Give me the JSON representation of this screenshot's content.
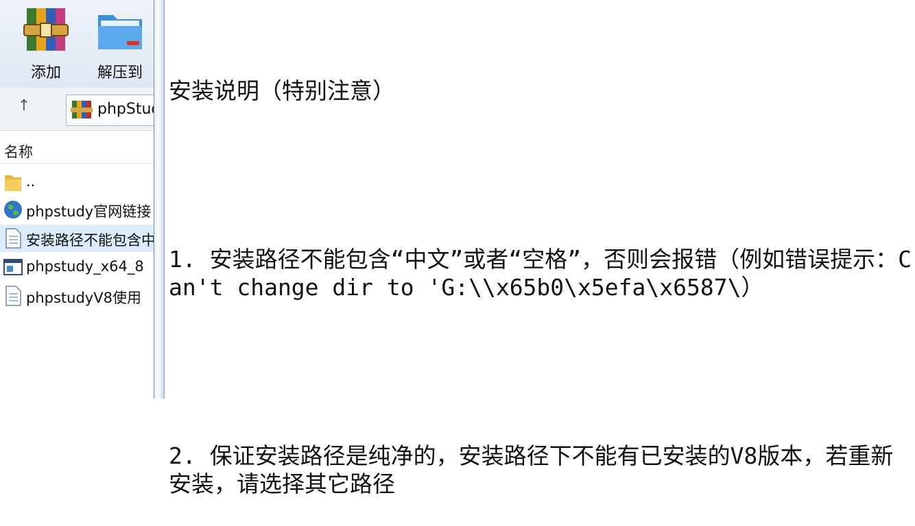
{
  "toolbar": {
    "buttons": [
      {
        "label": "添加",
        "icon": "winrar-add-icon"
      },
      {
        "label": "解压到",
        "icon": "extract-folder-icon"
      }
    ]
  },
  "addressbar": {
    "up_icon": "↑",
    "path": "phpStudy"
  },
  "filelist": {
    "column_header": "名称",
    "items": [
      {
        "name": "..",
        "icon": "folder-icon"
      },
      {
        "name": "phpstudy官网链接",
        "icon": "web-link-icon"
      },
      {
        "name": "安装路径不能包含中文",
        "icon": "text-file-icon"
      },
      {
        "name": "phpstudy_x64_8",
        "icon": "installer-icon"
      },
      {
        "name": "phpstudyV8使用",
        "icon": "text-file-icon"
      }
    ]
  },
  "document": {
    "title": "安装说明（特别注意）",
    "para1": "1. 安装路径不能包含“中文”或者“空格”，否则会报错（例如错误提示：Can't change dir to 'G:\\\\x65b0\\x5efa\\x6587\\）",
    "para2": "2. 保证安装路径是纯净的，安装路径下不能有已安装的V8版本，若重新安装，请选择其它路径"
  }
}
